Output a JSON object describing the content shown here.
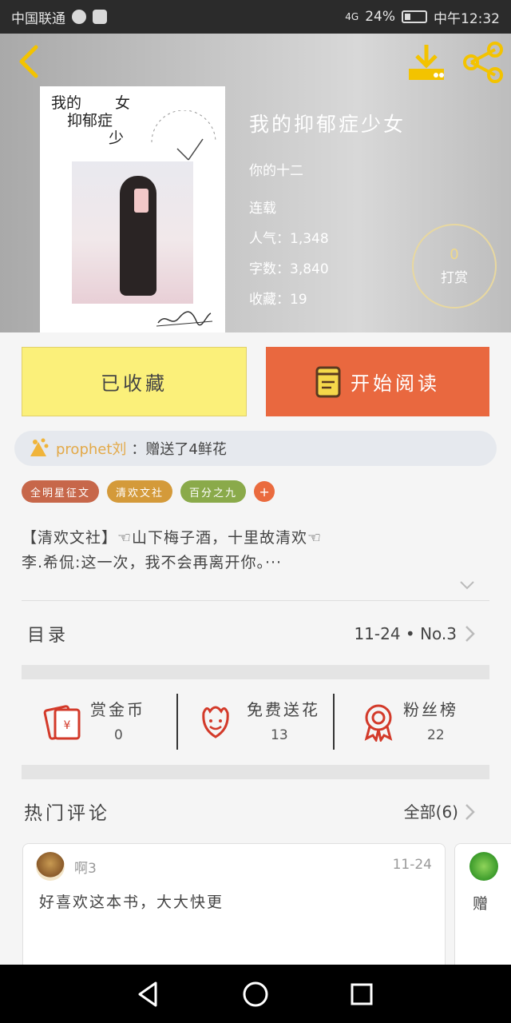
{
  "status_bar": {
    "carrier": "中国联通",
    "battery": "24%",
    "time": "中午12:32",
    "signal": "4G"
  },
  "header": {
    "back_icon": "back-arrow-icon",
    "download_icon": "download-icon",
    "share_icon": "share-icon",
    "accent_color": "#f3c300"
  },
  "cover": {
    "title_line1": "我的",
    "title_line2": "女",
    "title_line3": "抑郁症",
    "title_line4": "少"
  },
  "book": {
    "title": "我的抑郁症少女",
    "author": "你的十二",
    "status": "连载",
    "popularity": "人气：1,348",
    "word_count": "字数：3,840",
    "favorites": "收藏：19"
  },
  "reward": {
    "count": "0",
    "label": "打赏"
  },
  "actions": {
    "favorited_label": "已收藏",
    "read_label": "开始阅读",
    "favorited_color": "#fbf07a",
    "read_color": "#e9683f"
  },
  "flower_banner": {
    "user": "prophet刘",
    "text": "：赠送了4鲜花"
  },
  "tags": [
    {
      "label": "全明星征文",
      "color": "#c7674a"
    },
    {
      "label": "清欢文社",
      "color": "#d49a3a"
    },
    {
      "label": "百分之九",
      "color": "#8aaa4a"
    }
  ],
  "tag_add": "+",
  "description": {
    "line1": "【清欢文社】☜山下梅子酒，十里故清欢☜",
    "line2": "李.希侃:这一次，我不会再离开你。···"
  },
  "catalog": {
    "label": "目录",
    "latest": "11-24 • No.3"
  },
  "stats": [
    {
      "label": "赏金币",
      "value": "0",
      "icon": "red-envelope-icon"
    },
    {
      "label": "免费送花",
      "value": "13",
      "icon": "flower-smile-icon"
    },
    {
      "label": "粉丝榜",
      "value": "22",
      "icon": "medal-icon"
    }
  ],
  "hot_comments": {
    "title": "热门评论",
    "all_label": "全部(6)",
    "items": [
      {
        "user": "啊3",
        "date": "11-24",
        "text": "好喜欢这本书，大大快更"
      },
      {
        "text": "赠"
      }
    ]
  },
  "nav": {
    "back": "nav-back-icon",
    "home": "nav-home-icon",
    "recent": "nav-recent-icon"
  }
}
